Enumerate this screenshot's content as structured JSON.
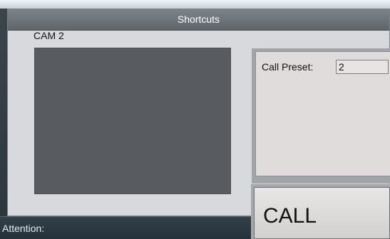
{
  "dialog": {
    "title": "Shortcuts"
  },
  "camera": {
    "label": "CAM 2"
  },
  "preset": {
    "label": "Call Preset:",
    "value": "2"
  },
  "actions": {
    "call_label": "CALL"
  },
  "status": {
    "text": "Attention:"
  },
  "colors": {
    "titlebar": "#6e767b",
    "dialog_bg": "#d7d9dc",
    "camera_view": "#585b5f",
    "status_bg": "#2c3840"
  }
}
